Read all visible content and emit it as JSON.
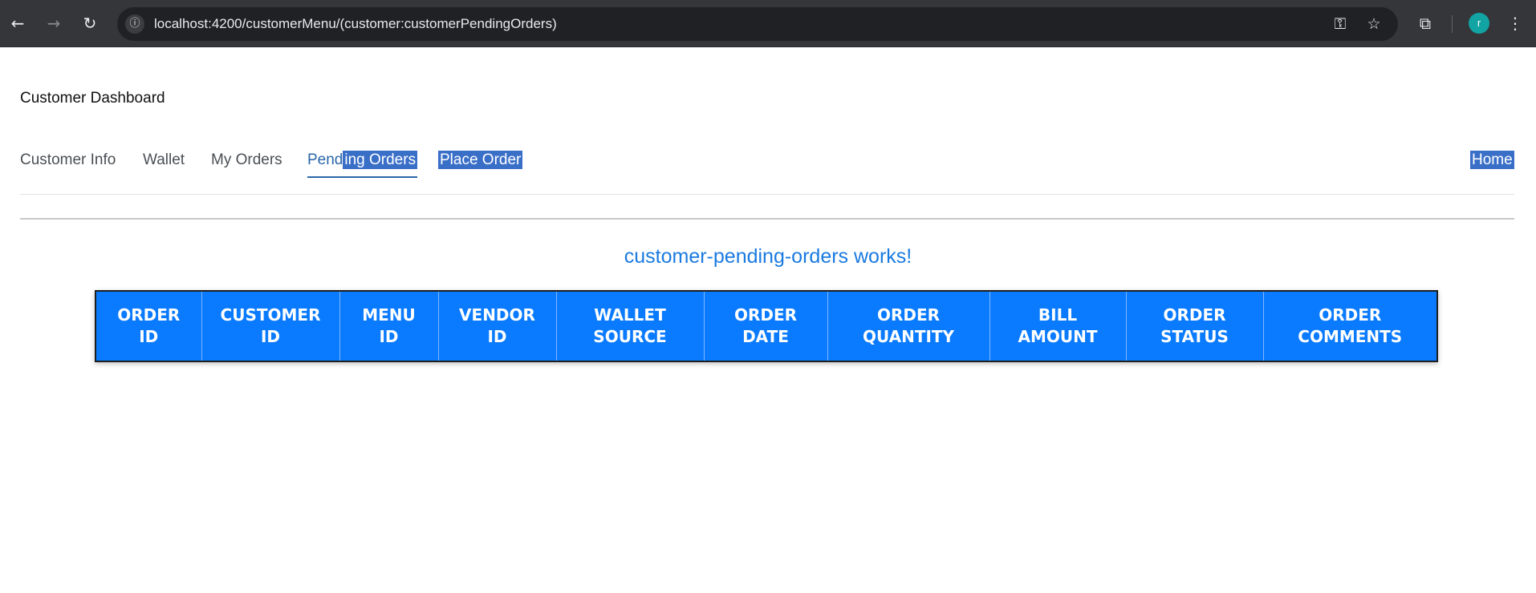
{
  "browser": {
    "url": "localhost:4200/customerMenu/(customer:customerPendingOrders)",
    "avatar_initial": "r",
    "icons": [
      "back-arrow-icon",
      "forward-arrow-icon",
      "reload-icon",
      "site-info-icon",
      "key-icon",
      "star-icon",
      "extensions-icon",
      "menu-dots-icon"
    ]
  },
  "page": {
    "title": "Customer Dashboard",
    "nav": {
      "customer_info": "Customer Info",
      "wallet": "Wallet",
      "my_orders": "My Orders",
      "pending_orders_a": "Pend",
      "pending_orders_b": "ing Orders",
      "place_order": "Place Order",
      "home": "Home"
    },
    "works_text": "customer-pending-orders works!",
    "table": {
      "headers": [
        [
          "ORDER",
          "ID"
        ],
        [
          "CUSTOMER",
          "ID"
        ],
        [
          "MENU",
          "ID"
        ],
        [
          "VENDOR",
          "ID"
        ],
        [
          "WALLET",
          "SOURCE"
        ],
        [
          "ORDER",
          "DATE"
        ],
        [
          "ORDER",
          "QUANTITY"
        ],
        [
          "BILL",
          "AMOUNT"
        ],
        [
          "ORDER",
          "STATUS"
        ],
        [
          "ORDER",
          "COMMENTS"
        ]
      ]
    }
  },
  "colors": {
    "table_header_bg": "#0a7bff",
    "active_tab": "#2a66a8",
    "selection": "#3a6fc8",
    "works_text": "#1a7ae0"
  }
}
